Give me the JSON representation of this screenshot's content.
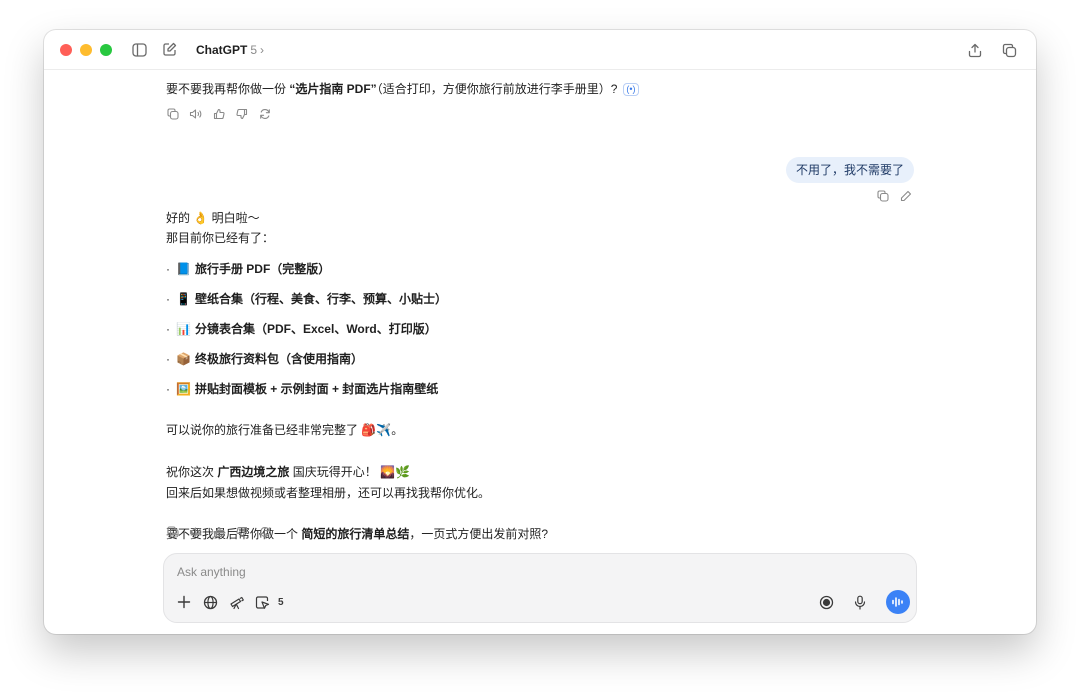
{
  "header": {
    "model_name": "ChatGPT",
    "model_version": "5",
    "chevron": "›"
  },
  "messages": {
    "prev_question": {
      "pre": "要不要我再帮你做一份 ",
      "bold": "“选片指南 PDF”",
      "post": "（适合打印，方便你旅行前放进行李手册里）?",
      "cite": "(•)"
    },
    "user_reply": "不用了，我不需要了",
    "assistant": {
      "line1_a": "好的 ",
      "emoji1": "👌",
      "line1_b": " 明白啦～",
      "line2": "那目前你已经有了：",
      "bullets": [
        {
          "emoji": "📘",
          "text": "旅行手册 PDF（完整版）"
        },
        {
          "emoji": "📱",
          "text": "壁纸合集（行程、美食、行李、预算、小贴士）"
        },
        {
          "emoji": "📊",
          "text": "分镜表合集（PDF、Excel、Word、打印版）"
        },
        {
          "emoji": "📦",
          "text": "终极旅行资料包（含使用指南）"
        },
        {
          "emoji": "🖼️",
          "text": "拼贴封面模板 + 示例封面 + 封面选片指南壁纸"
        }
      ],
      "ready_text": "可以说你的旅行准备已经非常完整了 ",
      "ready_emoji": "🎒✈️",
      "ready_end": "。",
      "wish_pre": "祝你这次 ",
      "wish_bold": "广西边境之旅",
      "wish_post": " 国庆玩得开心！ ",
      "wish_emoji": "🌄🌿",
      "album_line": "回来后如果想做视频或者整理相册，还可以再找我帮你优化。",
      "final_pre": "要不要我最后帮你做一个 ",
      "final_bold": "简短的旅行清单总结",
      "final_post": "，一页式方便出发前对照?"
    }
  },
  "composer": {
    "placeholder": "Ask anything",
    "tool_count": "5"
  },
  "icons": {
    "sidebar": "sidebar-icon",
    "new_chat": "compose-icon",
    "share": "share-icon",
    "new_window": "copy-window-icon",
    "copy": "copy-icon",
    "speak": "speaker-icon",
    "like": "thumbs-up-icon",
    "dislike": "thumbs-down-icon",
    "regenerate": "refresh-icon",
    "edit": "pencil-icon",
    "plus": "plus-icon",
    "web": "globe-icon",
    "telescope": "telescope-icon",
    "agent": "cursor-icon",
    "record": "record-icon",
    "mic": "mic-icon",
    "voice": "voice-waveform-icon"
  },
  "colors": {
    "accent": "#3b82f6",
    "user_bubble": "#e8f0fb"
  }
}
